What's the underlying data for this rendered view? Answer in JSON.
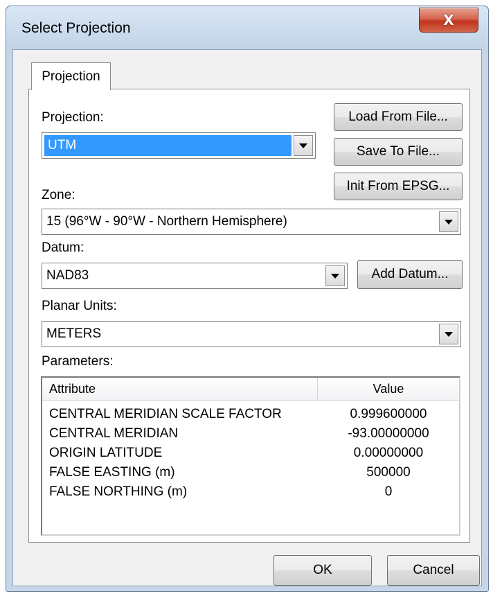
{
  "window": {
    "title": "Select Projection",
    "close_glyph": "X"
  },
  "tabs": [
    {
      "label": "Projection",
      "active": true
    }
  ],
  "projection": {
    "label": "Projection:",
    "value": "UTM"
  },
  "buttons": {
    "load_from_file": "Load From File...",
    "save_to_file": "Save To File...",
    "init_from_epsg": "Init From EPSG...",
    "add_datum": "Add Datum...",
    "ok": "OK",
    "cancel": "Cancel"
  },
  "zone": {
    "label": "Zone:",
    "value": "15 (96°W - 90°W - Northern Hemisphere)"
  },
  "datum": {
    "label": "Datum:",
    "value": "NAD83"
  },
  "planar_units": {
    "label": "Planar Units:",
    "value": "METERS"
  },
  "parameters": {
    "label": "Parameters:",
    "columns": [
      "Attribute",
      "Value"
    ],
    "rows": [
      {
        "attribute": "CENTRAL MERIDIAN SCALE FACTOR",
        "value": "0.999600000"
      },
      {
        "attribute": "CENTRAL MERIDIAN",
        "value": "-93.00000000"
      },
      {
        "attribute": "ORIGIN LATITUDE",
        "value": "0.00000000"
      },
      {
        "attribute": "FALSE EASTING (m)",
        "value": "500000"
      },
      {
        "attribute": "FALSE NORTHING (m)",
        "value": "0"
      }
    ]
  },
  "colors": {
    "selection": "#3399ff",
    "close_button": "#c2331d",
    "dialog_frame": "#c6d6e8"
  }
}
